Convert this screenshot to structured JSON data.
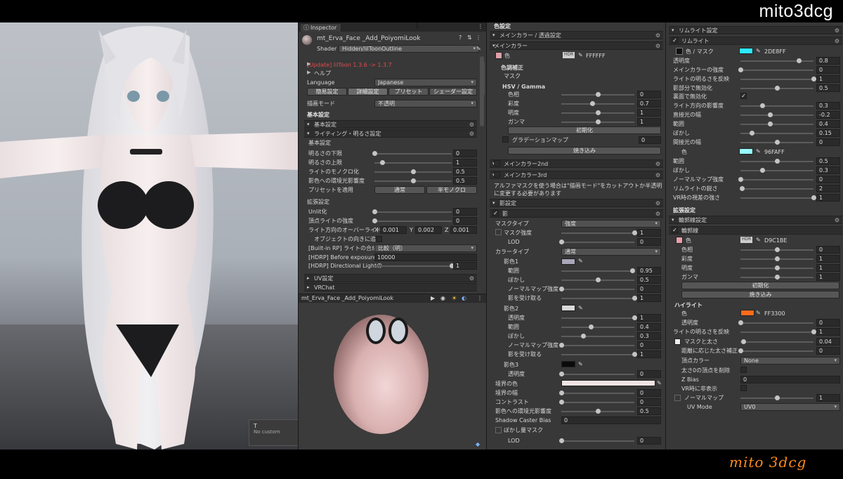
{
  "watermark": "mito3dcg",
  "signature": "mito 3dcg",
  "viewport": {
    "tooltip_title": "T",
    "tooltip_text": "No custom"
  },
  "inspector": {
    "tab": "Inspector",
    "material_name": "mt_Erva_Face _Add_PoiyomiLook",
    "shader_label": "Shader",
    "shader_value": "Hidden/lilToonOutline",
    "update_notice": "[Update] lilToon 1.3.6 -> 1.3.7",
    "help": "ヘルプ",
    "language_label": "Language",
    "language_value": "Japanese",
    "mode_tabs": [
      "簡易設定",
      "詳細設定",
      "プリセット",
      "シェーダー設定"
    ],
    "render_mode_label": "描画モード",
    "render_mode_value": "不透明",
    "basic_title": "基本設定",
    "basic_fold": "基本設定",
    "lighting_fold": "ライティング・明るさ設定",
    "basic_sub": "基本設定",
    "lighting": [
      {
        "label": "明るさの下限",
        "value": "0",
        "pos": 0.0
      },
      {
        "label": "明るさの上限",
        "value": "1",
        "pos": 0.1
      },
      {
        "label": "ライトのモノクロ化",
        "value": "0.5",
        "pos": 0.5
      },
      {
        "label": "影色への環境光影響度",
        "value": "0.5",
        "pos": 0.5
      }
    ],
    "preset_label": "プリセットを適用",
    "preset_buttons": [
      "通常",
      "半モノクロ"
    ],
    "extended_title": "拡張設定",
    "extended": [
      {
        "label": "Unlit化",
        "value": "0",
        "pos": 0.0
      },
      {
        "label": "頂点ライトの強度",
        "value": "0",
        "pos": 0.0
      }
    ],
    "light_dir_label": "ライト方向のオーバーライド",
    "light_dir": [
      {
        "axis": "X",
        "value": "0.001"
      },
      {
        "axis": "Y",
        "value": "0.002"
      },
      {
        "axis": "Z",
        "value": "0.001"
      }
    ],
    "object_dir_label": "オブジェクトの向きに追従",
    "builtin_label": "[Built-in RP] ライトの合成",
    "builtin_value": "比較（明）",
    "hdrp_before_label": "[HDRP] Before exposure lim",
    "hdrp_before_value": "10000",
    "hdrp_dir_label": "[HDRP] Directional Lightの",
    "hdrp_dir_value": "1",
    "uv_fold": "UV設定",
    "vrchat_fold": "VRChat",
    "preview_title": "mt_Erva_Face _Add_PoiyomiLook"
  },
  "mid": {
    "section_title": "色設定",
    "main_fold": "メインカラー / 透過設定",
    "main_sub": "メインカラー",
    "color_label": "色",
    "main_color_hex": "FFFFFF",
    "main_color": "#ffffff",
    "correction_title": "色調補正",
    "mask_label": "マスク",
    "hsv_title": "HSV / Gamma",
    "hsv": [
      {
        "label": "色相",
        "value": "0",
        "pos": 0.5
      },
      {
        "label": "彩度",
        "value": "0.7",
        "pos": 0.42
      },
      {
        "label": "明度",
        "value": "1",
        "pos": 0.5
      },
      {
        "label": "ガンマ",
        "value": "1",
        "pos": 0.5
      }
    ],
    "init_button": "初期化",
    "gradient_label": "グラデーションマップ",
    "gradient_value": "0",
    "bake_button": "焼き込み",
    "main2_label": "メインカラー2nd",
    "main3_label": "メインカラー3rd",
    "alpha_note": "アルファマスクを使う場合は\"描画モード\"をカットアウトか半透明に変更する必要があります",
    "shadow_fold": "影設定",
    "shadow_sub": "影",
    "mask_type_label": "マスクタイプ",
    "mask_type_value": "強度",
    "mask_strength_label": "マスク強度",
    "mask_strength_value": "1",
    "lod1_label": "LOD",
    "lod1_value": "0",
    "color_type_label": "カラータイプ",
    "color_type_value": "通常",
    "shadow1_label": "影色1",
    "shadow1_color": "#a8a6b8",
    "shadow1_rows": [
      {
        "label": "範囲",
        "value": "0.95",
        "pos": 0.97
      },
      {
        "label": "ぼかし",
        "value": "0.5",
        "pos": 0.5
      },
      {
        "label": "ノーマルマップ強度",
        "value": "0",
        "pos": 0.0
      },
      {
        "label": "影を受け取る",
        "value": "1",
        "pos": 1.0
      }
    ],
    "shadow2_label": "影色2",
    "shadow2_color": "#d9d9d9",
    "shadow2_rows": [
      {
        "label": "透明度",
        "value": "1",
        "pos": 1.0
      },
      {
        "label": "範囲",
        "value": "0.4",
        "pos": 0.4
      },
      {
        "label": "ぼかし",
        "value": "0.3",
        "pos": 0.3
      },
      {
        "label": "ノーマルマップ強度",
        "value": "0",
        "pos": 0.0
      },
      {
        "label": "影を受け取る",
        "value": "1",
        "pos": 1.0
      }
    ],
    "shadow3_label": "影色3",
    "shadow3_color": "#0a0a0a",
    "shadow3_alpha_label": "透明度",
    "shadow3_alpha_value": "0",
    "border_color_label": "境界の色",
    "border_color": "#f0e4e4",
    "border_rows": [
      {
        "label": "境界の幅",
        "value": "0",
        "pos": 0.0
      },
      {
        "label": "コントラスト",
        "value": "0",
        "pos": 0.0
      },
      {
        "label": "影色への環境光影響度",
        "value": "0.5",
        "pos": 0.5
      }
    ],
    "caster_label": "Shadow Caster Bias",
    "caster_value": "0",
    "blur_mask_label": "ぼかし量マスク",
    "lod2_label": "LOD",
    "lod2_value": "0"
  },
  "right": {
    "rim_fold": "リムライト設定",
    "rim_sub": "リムライト",
    "rim_color_label": "色 / マスク",
    "rim_color_hex": "2DE8FF",
    "rim_color": "#2de8ff",
    "rim_rows": [
      {
        "label": "透明度",
        "value": "0.8",
        "pos": 0.8
      },
      {
        "label": "メインカラーの強度",
        "value": "0",
        "pos": 0.0
      },
      {
        "label": "ライトの明るさを反映",
        "value": "1",
        "pos": 1.0
      },
      {
        "label": "影部分で無効化",
        "value": "0.5",
        "pos": 0.5
      }
    ],
    "backface_label": "裏面で無効化",
    "rim_rows2": [
      {
        "label": "ライト方向の影響度",
        "value": "0.3",
        "pos": 0.3
      },
      {
        "label": "直接光の幅",
        "value": "-0.2",
        "pos": 0.4
      },
      {
        "label": "範囲",
        "value": "0.4",
        "pos": 0.4
      },
      {
        "label": "ぼかし",
        "value": "0.15",
        "pos": 0.15
      },
      {
        "label": "間接光の幅",
        "value": "0",
        "pos": 0.5
      }
    ],
    "indirect_color_label": "色",
    "indirect_color_hex": "96FAFF",
    "indirect_color": "#96faff",
    "rim_rows3": [
      {
        "label": "範囲",
        "value": "0.5",
        "pos": 0.5
      },
      {
        "label": "ぼかし",
        "value": "0.3",
        "pos": 0.3
      },
      {
        "label": "ノーマルマップ強度",
        "value": "0",
        "pos": 0.0
      },
      {
        "label": "リムライトの鋭さ",
        "value": "2",
        "pos": 0.02
      },
      {
        "label": "VR時の視差の強さ",
        "value": "1",
        "pos": 1.0
      }
    ],
    "ext_title": "拡張設定",
    "outline_fold": "輪郭線設定",
    "outline_sub": "輪郭線",
    "outline_color_label": "色",
    "outline_color_hex": "D9C1BE",
    "outline_color": "#d9c1be",
    "outline_hsv": [
      {
        "label": "色相",
        "value": "0",
        "pos": 0.5
      },
      {
        "label": "彩度",
        "value": "1",
        "pos": 0.5
      },
      {
        "label": "明度",
        "value": "1",
        "pos": 0.5
      },
      {
        "label": "ガンマ",
        "value": "1",
        "pos": 0.5
      }
    ],
    "init_button": "初期化",
    "bake_button": "焼き込み",
    "highlight_title": "ハイライト",
    "hl_color_label": "色",
    "hl_color_hex": "FF3300",
    "hl_color": "#ff6a1a",
    "hl_alpha_label": "透明度",
    "hl_alpha_value": "0",
    "hl_light_label": "ライトの明るさを反映",
    "hl_light_value": "1",
    "width_label": "マスクと太さ",
    "width_value": "0.04",
    "dist_label": "距離に応じた太さ補正",
    "dist_value": "0",
    "vertex_label": "頂点カラー",
    "vertex_value": "None",
    "delete_label": "太さ0の頂点を削除",
    "zbias_label": "Z Bias",
    "zbias_value": "0",
    "vr_hide_label": "VR時に非表示",
    "normal_label": "ノーマルマップ",
    "normal_value": "1",
    "uvmode_label": "UV Mode",
    "uvmode_value": "UV0"
  }
}
